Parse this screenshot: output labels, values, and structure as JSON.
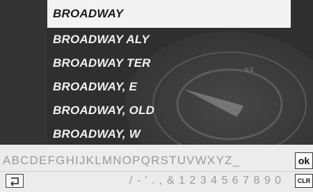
{
  "results": [
    {
      "label": "BROADWAY",
      "selected": true
    },
    {
      "label": "BROADWAY ALY",
      "selected": false
    },
    {
      "label": "BROADWAY TER",
      "selected": false
    },
    {
      "label": "BROADWAY, E",
      "selected": false
    },
    {
      "label": "BROADWAY, OLD",
      "selected": false
    },
    {
      "label": "BROADWAY, W",
      "selected": false
    }
  ],
  "keyboard": {
    "letters": "ABCDEFGHIJKLMNOPQRSTUVWXYZ_",
    "ok_label": "ok",
    "symbols": "/ - ' . , & 1 2 3 4 5 6 7 8 9 0",
    "clr_label": "CLR",
    "back_icon": "back-arrow-icon"
  },
  "compass_text": "N E"
}
